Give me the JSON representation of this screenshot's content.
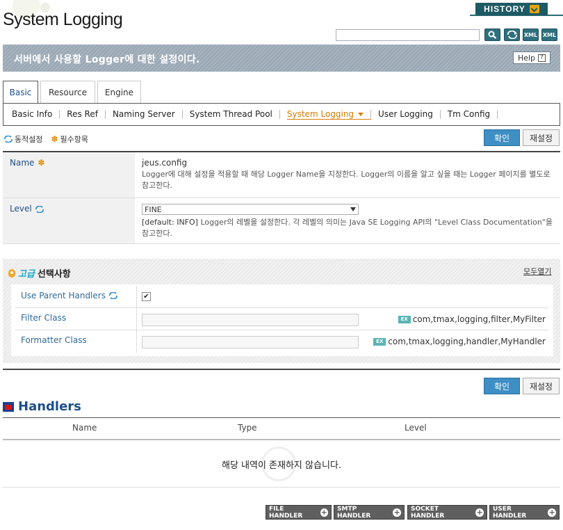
{
  "header": {
    "title": "System Logging",
    "history_label": "HISTORY",
    "search_placeholder": "",
    "tools": [
      "search-icon",
      "refresh-icon",
      "xml-export-icon",
      "xml-import-icon"
    ],
    "tool_labels": {
      "xml1": "XML",
      "xml2": "XML"
    }
  },
  "banner": {
    "text": "서버에서 사용할 Logger에 대한 설정이다.",
    "help_label": "Help"
  },
  "main_tabs": [
    "Basic",
    "Resource",
    "Engine"
  ],
  "subnav": [
    "Basic Info",
    "Res Ref",
    "Naming Server",
    "System Thread Pool",
    "System Logging",
    "User Logging",
    "Tm Config"
  ],
  "legend": {
    "dynamic": "동적설정",
    "required": "필수항목"
  },
  "buttons": {
    "ok": "확인",
    "reset": "재설정"
  },
  "form": {
    "name": {
      "label": "Name",
      "value": "jeus.config",
      "desc": "Logger에 대해 설정을 적용할 때 해당 Logger Name을 지정한다. Logger의 이름을 알고 싶을 때는 Logger 페이지를 별도로 참고한다."
    },
    "level": {
      "label": "Level",
      "selected": "FINE",
      "default": "[default: INFO]",
      "desc": "Logger의 레벨을 설정한다. 각 레벨의 의미는 Java SE Logging API의 \"Level Class Documentation\"을 참고한다."
    }
  },
  "advanced": {
    "title_hi": "고급",
    "title": "선택사항",
    "expand_all": "모두열기",
    "rows": {
      "parent": {
        "label": "Use Parent Handlers",
        "checked": "✔"
      },
      "filter": {
        "label": "Filter Class",
        "example": "com,tmax,logging,filter,MyFilter"
      },
      "formatter": {
        "label": "Formatter Class",
        "example": "com,tmax,logging,handler,MyHandler"
      }
    },
    "ex_badge": "EX"
  },
  "handlers": {
    "title": "Handlers",
    "columns": [
      "Name",
      "Type",
      "Level"
    ],
    "empty": "해당 내역이 존재하지 않습니다.",
    "buttons": [
      "FILE HANDLER",
      "SMTP HANDLER",
      "SOCKET HANDLER",
      "USER HANDLER"
    ]
  }
}
